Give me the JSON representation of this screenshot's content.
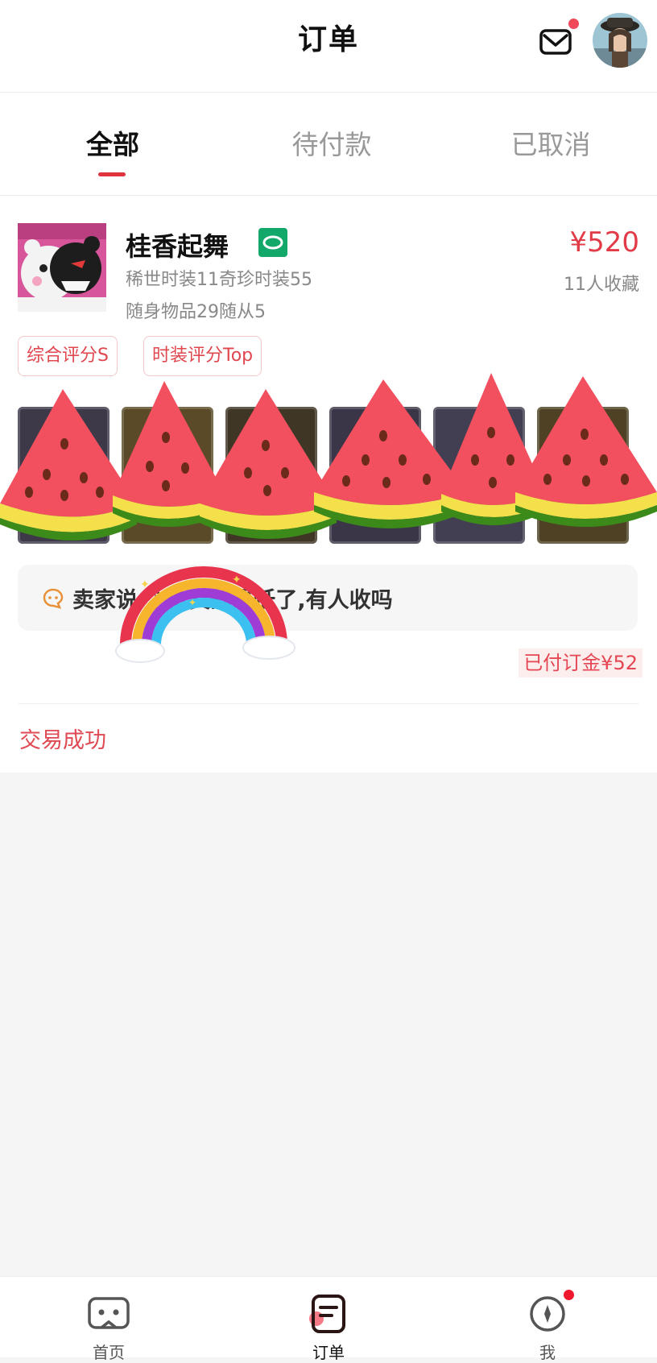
{
  "header": {
    "title": "订单"
  },
  "tabs": [
    {
      "label": "全部"
    },
    {
      "label": "待付款"
    },
    {
      "label": "已取消"
    }
  ],
  "order": {
    "seller_name": "桂香起舞",
    "price": "¥520",
    "favorites": "11人收藏",
    "detail_line1": "稀世时装11奇珍时装55",
    "detail_line2": "随身物品29随从5",
    "tags": [
      "综合评分S",
      "时装评分Top"
    ],
    "message": "卖家说      个价真的最低了,有人收吗",
    "deposit": "已付订金¥52",
    "status": "交易成功"
  },
  "nav": [
    {
      "label": "首页"
    },
    {
      "label": "订单"
    },
    {
      "label": "我"
    }
  ],
  "colors": {
    "accent": "#e0323f",
    "badge": "#12a86a",
    "watermelon": "#f2505f",
    "rind": "#3c8a1a"
  }
}
